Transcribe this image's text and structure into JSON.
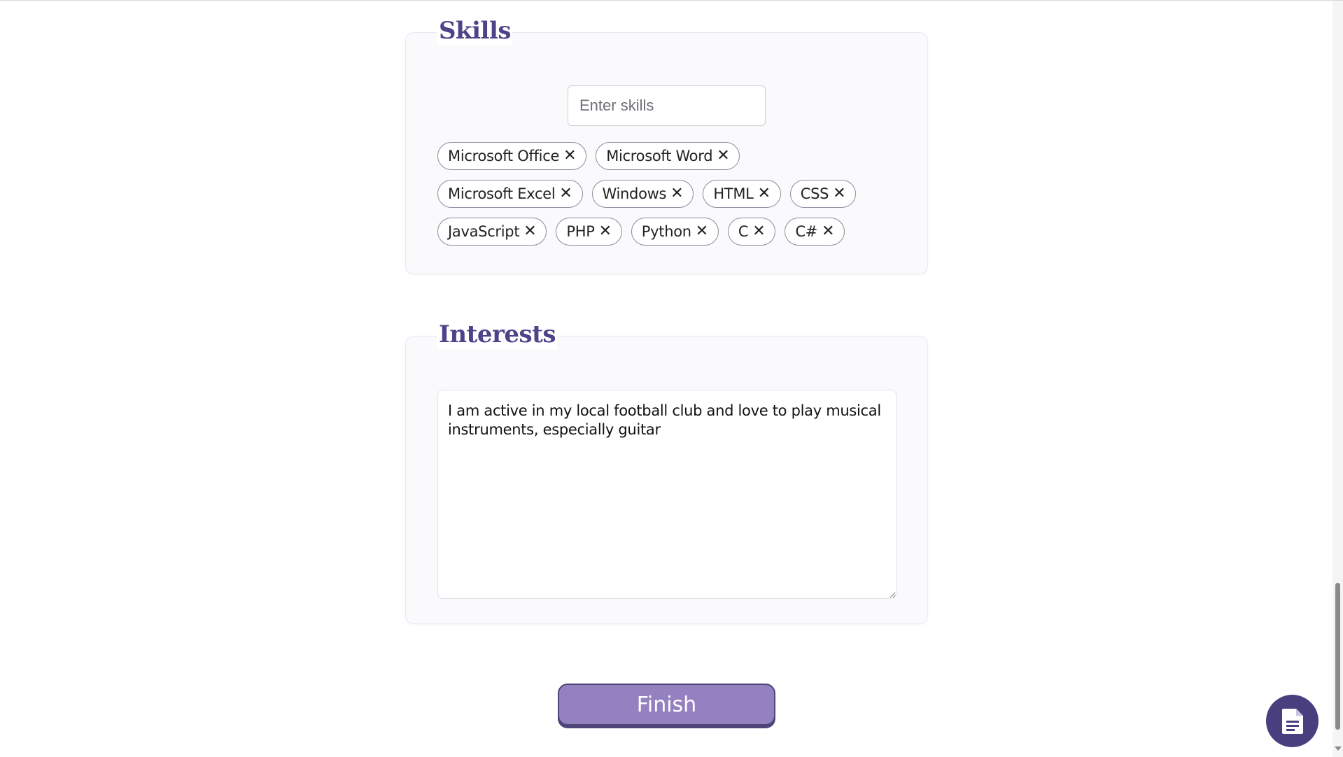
{
  "skills": {
    "title": "Skills",
    "input_placeholder": "Enter skills",
    "remove_icon": "close-icon",
    "tags": [
      {
        "label": "Microsoft Office",
        "remove": "✕"
      },
      {
        "label": "Microsoft Word",
        "remove": "✕"
      },
      {
        "label": "Microsoft Excel",
        "remove": "✕"
      },
      {
        "label": "Windows",
        "remove": "✕"
      },
      {
        "label": "HTML",
        "remove": "✕"
      },
      {
        "label": "CSS",
        "remove": "✕"
      },
      {
        "label": "JavaScript",
        "remove": "✕"
      },
      {
        "label": "PHP",
        "remove": "✕"
      },
      {
        "label": "Python",
        "remove": "✕"
      },
      {
        "label": "C",
        "remove": "✕"
      },
      {
        "label": "C#",
        "remove": "✕"
      }
    ]
  },
  "interests": {
    "title": "Interests",
    "text": "I am active in my local football club and love to play musical instruments, especially guitar"
  },
  "actions": {
    "finish_label": "Finish",
    "fab_icon": "document-icon"
  },
  "colors": {
    "accent": "#4e4389",
    "button": "#9580c0",
    "fab": "#4a3f7e"
  }
}
